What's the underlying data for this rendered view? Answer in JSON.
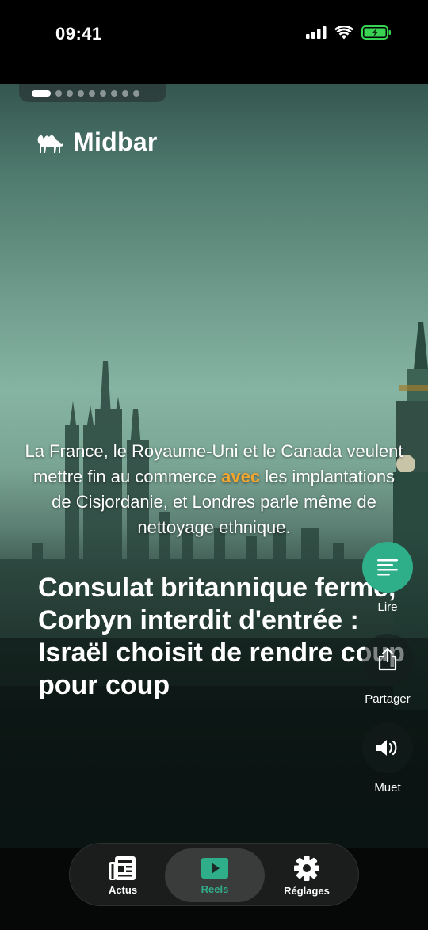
{
  "status_bar": {
    "time": "09:41"
  },
  "app": {
    "name": "Midbar"
  },
  "progress": {
    "count": 10,
    "active_index": 0
  },
  "reel": {
    "summary_before": "La France, le Royaume-Uni et le Canada veulent mettre fin au commerce ",
    "summary_highlight": "avec",
    "summary_after": " les implantations de Cisjordanie, et Londres parle même de nettoyage ethnique.",
    "headline": "Consulat britannique fermé, Corbyn interdit d'entrée : Israël choisit de rendre coup pour coup"
  },
  "actions": {
    "read_label": "Lire",
    "share_label": "Partager",
    "mute_label": "Muet"
  },
  "nav": {
    "items": [
      {
        "label": "Actus",
        "icon": "newspaper-icon"
      },
      {
        "label": "Reels",
        "icon": "play-icon"
      },
      {
        "label": "Réglages",
        "icon": "gear-icon"
      }
    ],
    "active": "Reels"
  },
  "colors": {
    "accent": "#2fae8a",
    "highlight": "#f2a630"
  }
}
